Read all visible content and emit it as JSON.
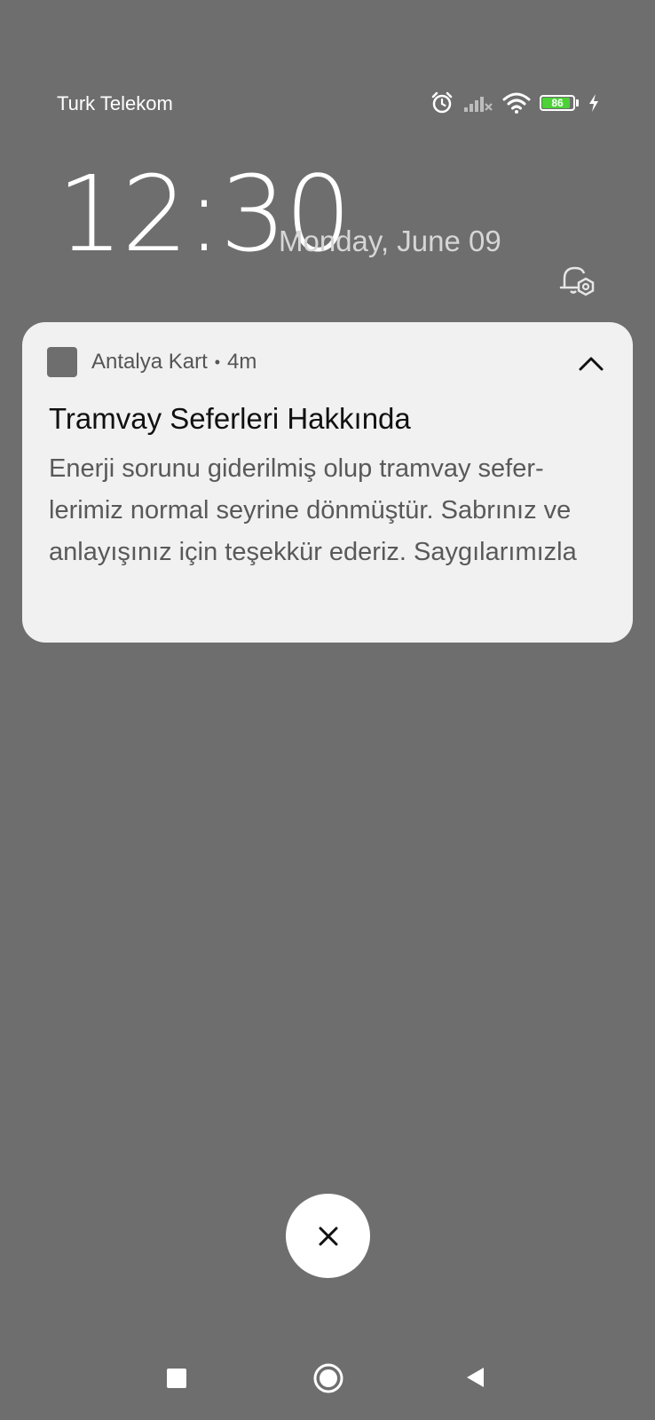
{
  "status_bar": {
    "carrier": "Turk Telekom",
    "battery_level": "86",
    "icons": [
      "alarm-icon",
      "signal-icon",
      "wifi-icon",
      "battery-icon",
      "charging-icon"
    ]
  },
  "lockscreen": {
    "time": "12:30",
    "date": "Monday, June 09"
  },
  "notification": {
    "app_name": "Antalya Kart",
    "time_ago": "4m",
    "title": "Tramvay Seferleri Hakkında",
    "body": "Enerji sorunu giderilmiş olup tramvay sefer-lerimiz normal seyrine dönmüştür. Sabrınız ve anlayışınız için teşekkür ederiz. Saygılarımızla"
  },
  "colors": {
    "background": "#6e6e6e",
    "card": "#f1f1f1",
    "battery_fill": "#4cd137"
  }
}
